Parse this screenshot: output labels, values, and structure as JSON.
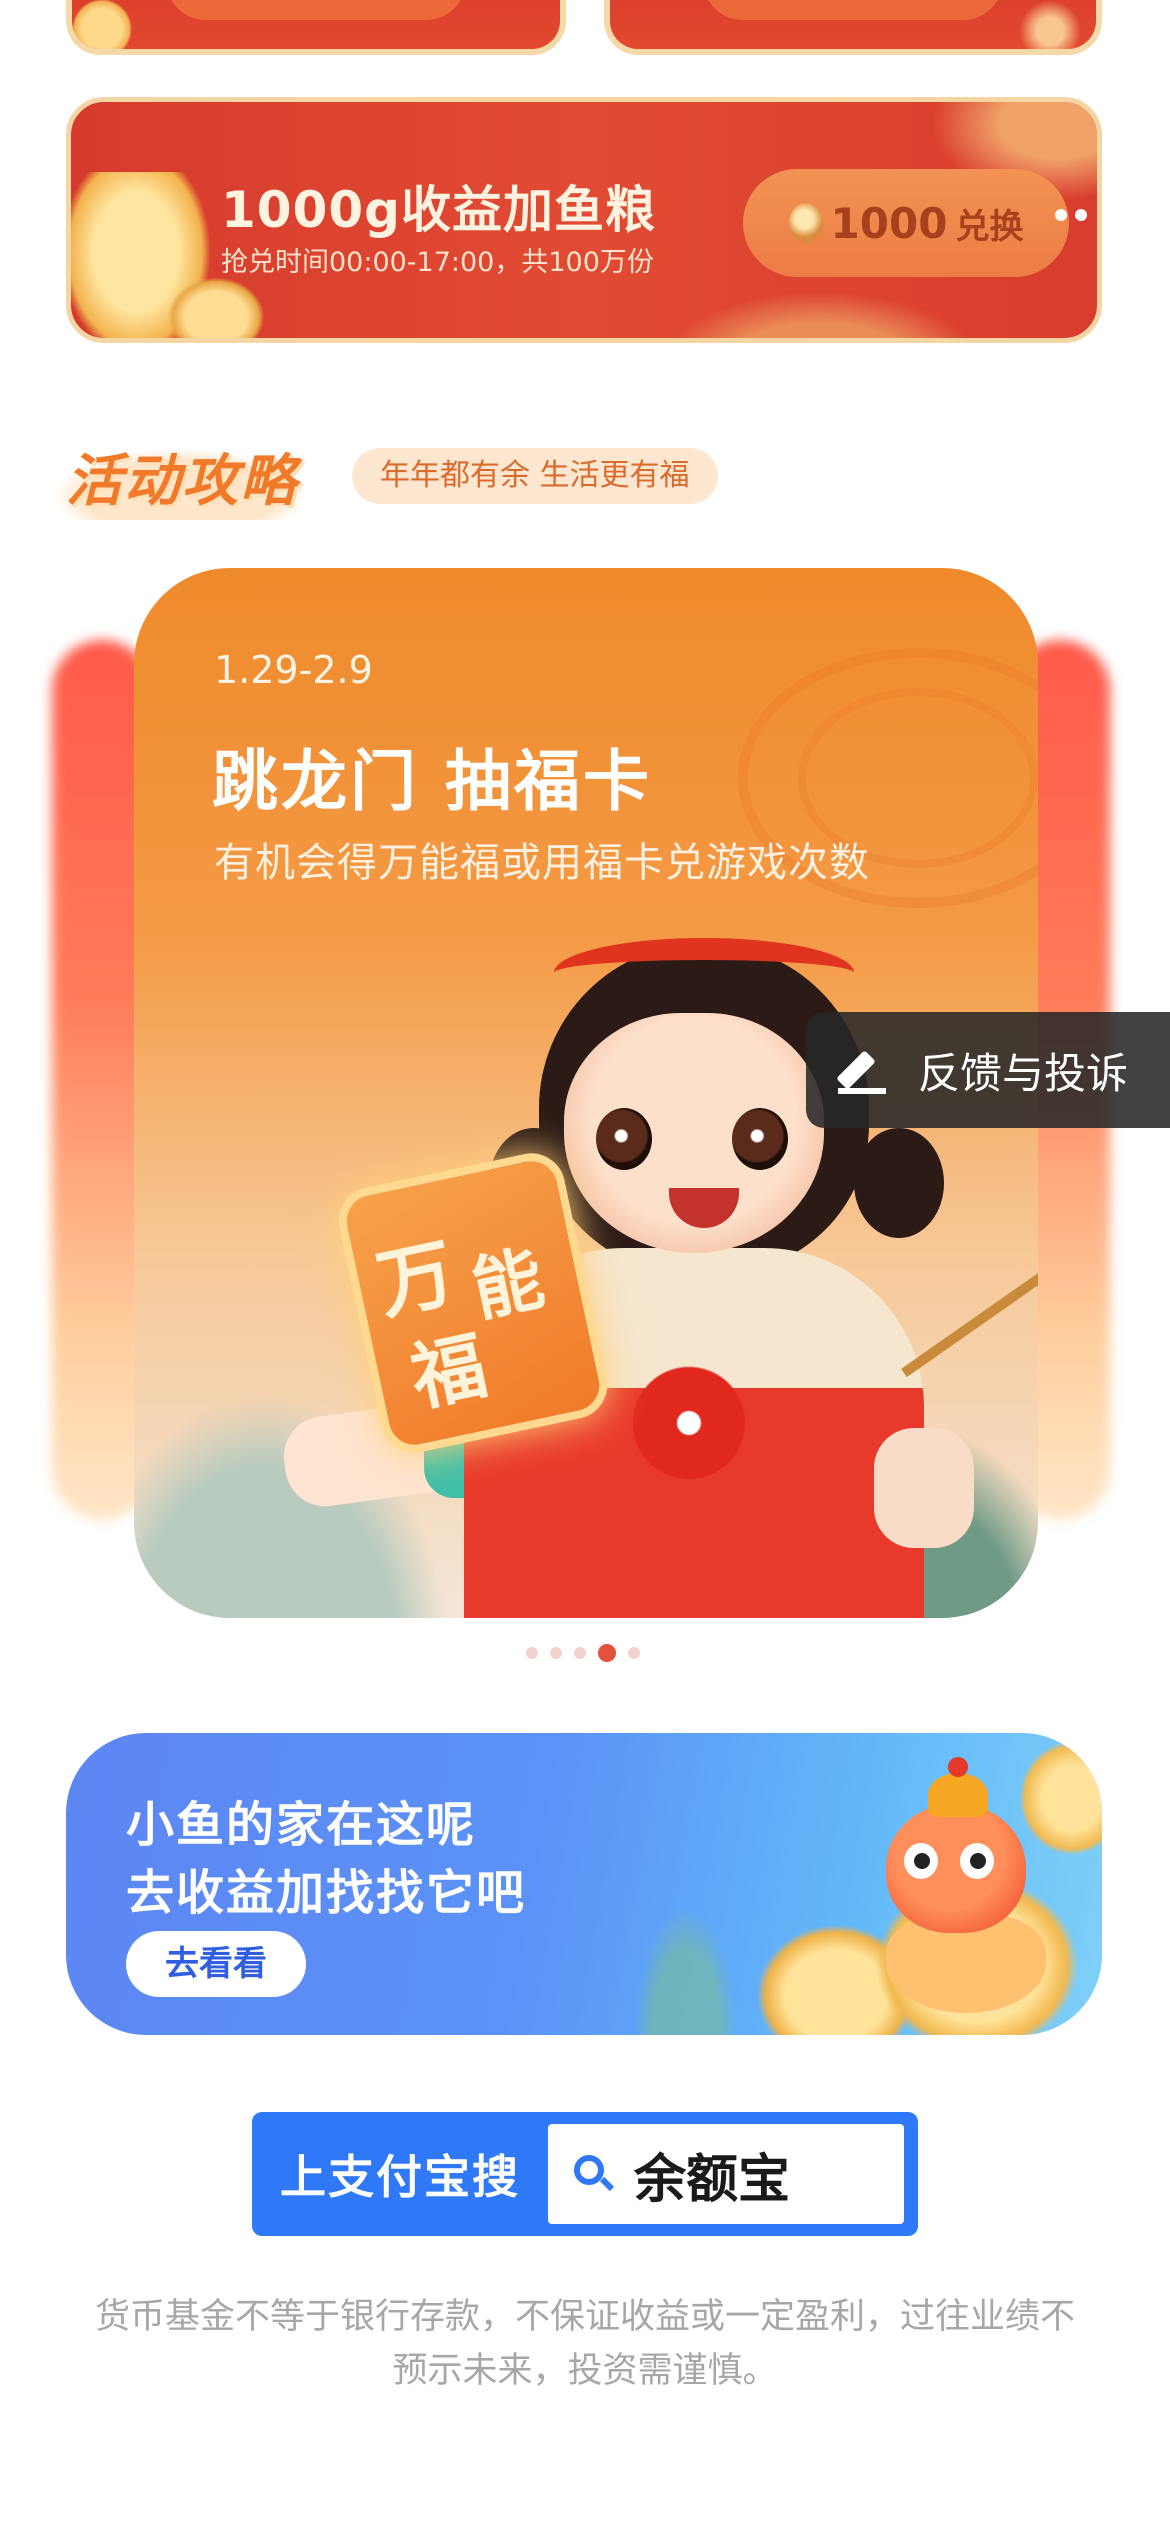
{
  "exchange_banner": {
    "title": "1000g收益加鱼粮",
    "subtitle": "抢兑时间00:00-17:00，共100万份",
    "button_amount": "1000",
    "button_label": "兑换"
  },
  "section": {
    "title": "活动攻略",
    "tag": "年年都有余 生活更有福"
  },
  "carousel": {
    "active_index": 3,
    "total": 5,
    "card": {
      "date": "1.29-2.9",
      "title": "跳龙门 抽福卡",
      "subtitle": "有机会得万能福或用福卡兑游戏次数",
      "fu_card_chars": [
        "万",
        "能",
        "福"
      ]
    }
  },
  "feedback": {
    "label": "反馈与投诉",
    "icon": "pen-icon"
  },
  "fish_banner": {
    "line1": "小鱼的家在这呢",
    "line2": "去收益加找找它吧",
    "button": "去看看"
  },
  "search": {
    "label": "上支付宝搜",
    "query": "余额宝",
    "icon": "search-icon"
  },
  "disclaimer": {
    "line1": "货币基金不等于银行存款，不保证收益或一定盈利，过往业绩不",
    "line2": "预示未来，投资需谨慎。"
  },
  "colors": {
    "banner_red": "#d63a2d",
    "accent_orange": "#f07a2a",
    "primary_blue": "#2f78f7",
    "dot_active": "#e2523c"
  }
}
